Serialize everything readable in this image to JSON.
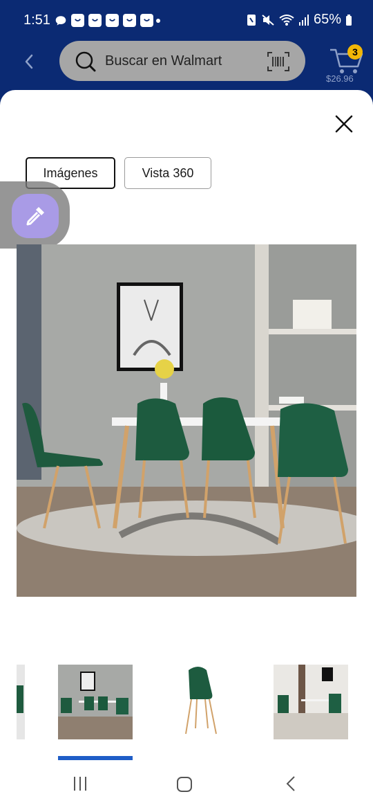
{
  "status_bar": {
    "time": "1:51",
    "battery": "65%",
    "notification_icons": [
      "chat-icon",
      "app-icon",
      "app-icon",
      "app-icon",
      "app-icon",
      "app-icon"
    ]
  },
  "search": {
    "placeholder": "Buscar en Walmart"
  },
  "cart": {
    "count": "3",
    "total": "$26.96"
  },
  "tabs": [
    {
      "label": "Imágenes",
      "selected": true
    },
    {
      "label": "Vista 360",
      "selected": false
    }
  ],
  "gallery": {
    "selected_index": 1,
    "thumbnail_count": 4
  },
  "colors": {
    "header": "#0b2a73",
    "cart_badge": "#f2b707",
    "indicator": "#1f5dc7",
    "float_button": "#a99be6"
  }
}
